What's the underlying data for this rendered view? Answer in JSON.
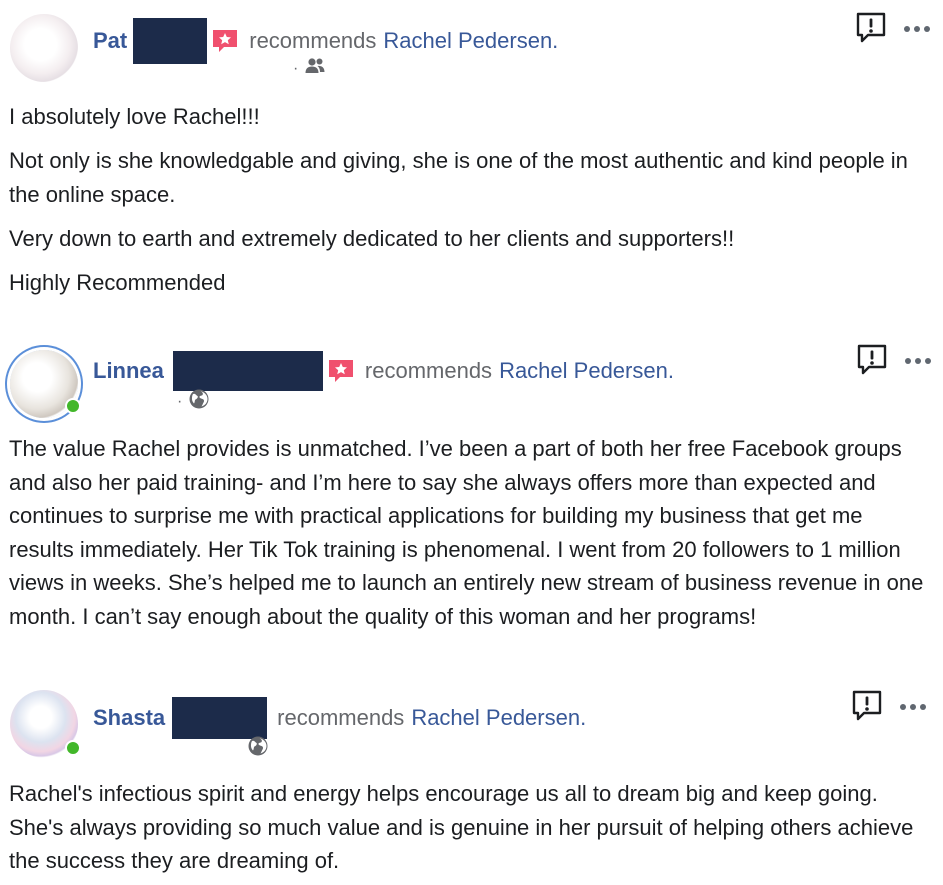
{
  "reviews": [
    {
      "author_first_name": "Pat",
      "action_text": "recommends",
      "page_name": "Rachel Pedersen.",
      "subline_separator": "·",
      "audience_icon": "friends-icon",
      "paragraphs": [
        "I absolutely love Rachel!!!",
        "Not only is she knowledgable and giving, she is one of the most authentic and kind people in the online space.",
        "Very down to earth and extremely dedicated to her clients and supporters!!",
        "Highly Recommended"
      ]
    },
    {
      "author_first_name": "Linnea",
      "action_text": "recommends",
      "page_name": "Rachel Pedersen.",
      "subline_separator": "·",
      "audience_icon": "globe-icon",
      "paragraphs": [
        "The value Rachel provides is unmatched. I’ve been a part of both her free Facebook groups and also her paid training- and I’m here to say she always offers more than expected and continues to surprise me with practical applications for building my business that get me results immediately. Her Tik Tok training is phenomenal. I went from 20 followers to 1 million views in weeks. She’s helped me to launch an entirely new stream of business revenue in one month. I can’t say enough about the quality of this woman and her programs!"
      ]
    },
    {
      "author_first_name": "Shasta",
      "action_text": "recommends",
      "page_name": "Rachel Pedersen.",
      "audience_icon": "globe-icon",
      "paragraphs": [
        "Rachel's infectious spirit and energy helps encourage us all to dream big and keep going. She's always providing so much value and is genuine in her pursuit of helping others achieve the success they are dreaming of."
      ]
    }
  ],
  "colors": {
    "link_blue": "#385898",
    "muted_gray": "#65676b",
    "redaction": "#1c2b4a",
    "recommend_badge": "#f0506e",
    "online_green": "#42b72a"
  },
  "icons": {
    "report": "report-icon",
    "more": "more-options-icon",
    "recommend": "recommend-star-icon"
  }
}
